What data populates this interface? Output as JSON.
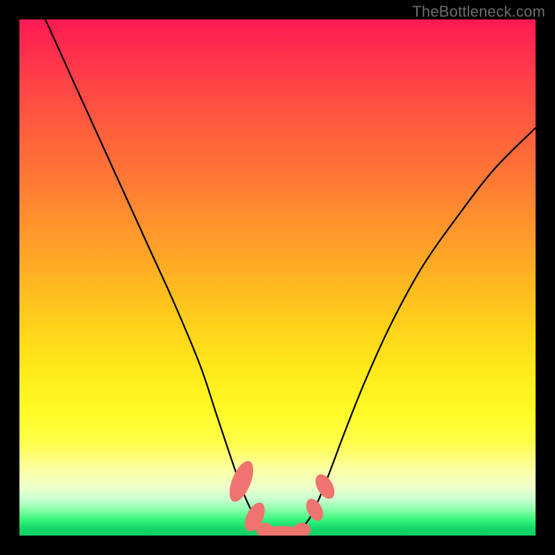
{
  "watermark": "TheBottleneck.com",
  "chart_data": {
    "type": "line",
    "title": "",
    "xlabel": "",
    "ylabel": "",
    "xlim": [
      0,
      100
    ],
    "ylim": [
      0,
      100
    ],
    "series": [
      {
        "name": "bottleneck-curve",
        "x": [
          0,
          5,
          10,
          15,
          20,
          25,
          30,
          35,
          38,
          41,
          43.5,
          46,
          48,
          50,
          52,
          54,
          56,
          58,
          60,
          63,
          67,
          72,
          78,
          85,
          92,
          100
        ],
        "values": [
          110,
          100,
          89,
          78,
          67,
          56,
          45,
          33,
          24,
          15,
          8,
          3,
          1.2,
          0.7,
          0.7,
          1.2,
          3,
          7,
          12,
          20,
          30,
          41,
          52,
          62,
          71,
          79
        ]
      }
    ],
    "markers": [
      {
        "x": 43.0,
        "y": 10.5,
        "rx": 1.8,
        "ry": 4.2,
        "rot": 22
      },
      {
        "x": 45.6,
        "y": 3.6,
        "rx": 1.6,
        "ry": 3.0,
        "rot": 26
      },
      {
        "x": 47.5,
        "y": 1.1,
        "rx": 1.7,
        "ry": 1.4,
        "rot": 0
      },
      {
        "x": 51.0,
        "y": 0.55,
        "rx": 4.2,
        "ry": 1.3,
        "rot": 0
      },
      {
        "x": 54.7,
        "y": 1.1,
        "rx": 1.7,
        "ry": 1.4,
        "rot": 0
      },
      {
        "x": 57.2,
        "y": 5.0,
        "rx": 1.4,
        "ry": 2.3,
        "rot": -28
      },
      {
        "x": 59.2,
        "y": 9.5,
        "rx": 1.5,
        "ry": 2.6,
        "rot": -30
      }
    ],
    "colors": {
      "curve": "#000000",
      "marker": "#ef7470"
    }
  }
}
